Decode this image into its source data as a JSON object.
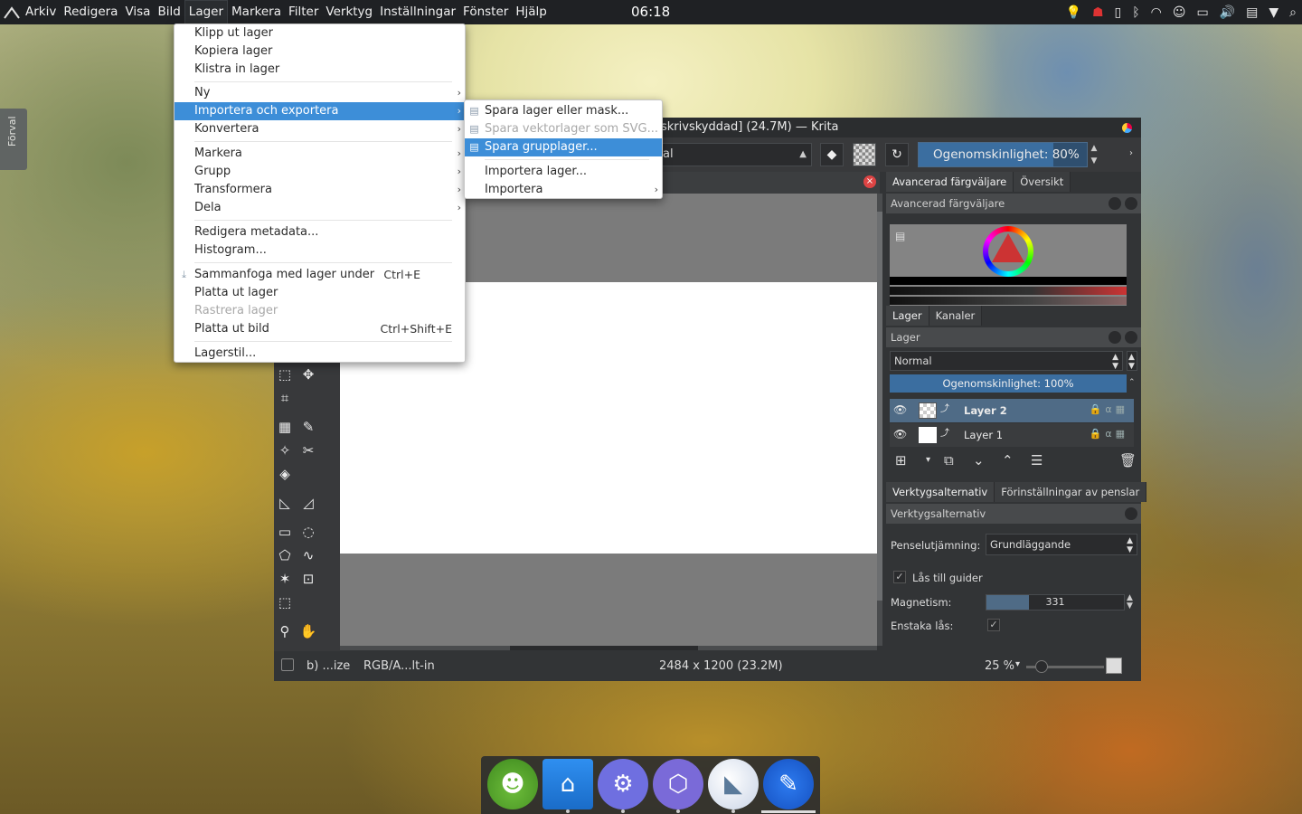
{
  "topbar": {
    "menu": [
      "Arkiv",
      "Redigera",
      "Visa",
      "Bild",
      "Lager",
      "Markera",
      "Filter",
      "Verktyg",
      "Inställningar",
      "Fönster",
      "Hjälp"
    ],
    "active_menu": "Lager",
    "clock": "06:18"
  },
  "side_tab": {
    "label": "Förval"
  },
  "window": {
    "title": "skrivskyddad] (24.7M) — Krita",
    "blend_combo": "al",
    "opacity_label": "Ogenomskinlighet:",
    "opacity_value": "80%",
    "opacity_fraction": 0.8
  },
  "lager_menu": {
    "items": [
      {
        "label": "Klipp ut lager"
      },
      {
        "label": "Kopiera lager"
      },
      {
        "label": "Klistra in lager"
      },
      {
        "label": "Ny",
        "submenu": true
      },
      {
        "label": "Importera och exportera",
        "submenu": true,
        "highlighted": true
      },
      {
        "label": "Konvertera",
        "submenu": true
      },
      {
        "label": "Markera",
        "submenu": true
      },
      {
        "label": "Grupp",
        "submenu": true
      },
      {
        "label": "Transformera",
        "submenu": true
      },
      {
        "label": "Dela",
        "submenu": true
      },
      {
        "label": "Redigera metadata..."
      },
      {
        "label": "Histogram..."
      },
      {
        "label": "Sammanfoga med lager under",
        "shortcut": "Ctrl+E"
      },
      {
        "label": "Platta ut lager"
      },
      {
        "label": "Rastrera lager",
        "disabled": true
      },
      {
        "label": "Platta ut bild",
        "shortcut": "Ctrl+Shift+E"
      },
      {
        "label": "Lagerstil..."
      }
    ]
  },
  "import_export_submenu": {
    "items": [
      {
        "label": "Spara lager eller mask..."
      },
      {
        "label": "Spara vektorlager som SVG...",
        "disabled": true
      },
      {
        "label": "Spara grupplager...",
        "highlighted": true
      },
      {
        "label": "Importera lager..."
      },
      {
        "label": "Importera",
        "submenu": true
      }
    ]
  },
  "dockers": {
    "color_tabs": [
      "Avancerad färgväljare",
      "Översikt"
    ],
    "color_header": "Avancerad färgväljare",
    "layer_tabs": [
      "Lager",
      "Kanaler"
    ],
    "layer_header": "Lager",
    "blend_mode": "Normal",
    "layer_opacity": "Ogenomskinlighet:  100%",
    "layers": [
      {
        "name": "Layer 2",
        "selected": true
      },
      {
        "name": "Layer 1",
        "selected": false
      }
    ],
    "tool_tabs": [
      "Verktygsalternativ",
      "Förinställningar av penslar"
    ],
    "tool_header": "Verktygsalternativ",
    "smoothing_label": "Penselutjämning:",
    "smoothing_value": "Grundläggande",
    "snap_label": "Lås till guider",
    "magnetism_label": "Magnetism:",
    "magnetism_value": "331",
    "magnetism_fraction": 0.31,
    "single_lock_label": "Enstaka lås:"
  },
  "statusbar": {
    "brush": "b) ...ize",
    "colorspace": "RGB/A...lt-in",
    "size": "2484 x 1200 (23.2M)",
    "zoom": "25 %"
  },
  "dock_apps": [
    "frog-app",
    "file-manager",
    "system-settings",
    "app-store",
    "eagle-browser",
    "krita"
  ]
}
